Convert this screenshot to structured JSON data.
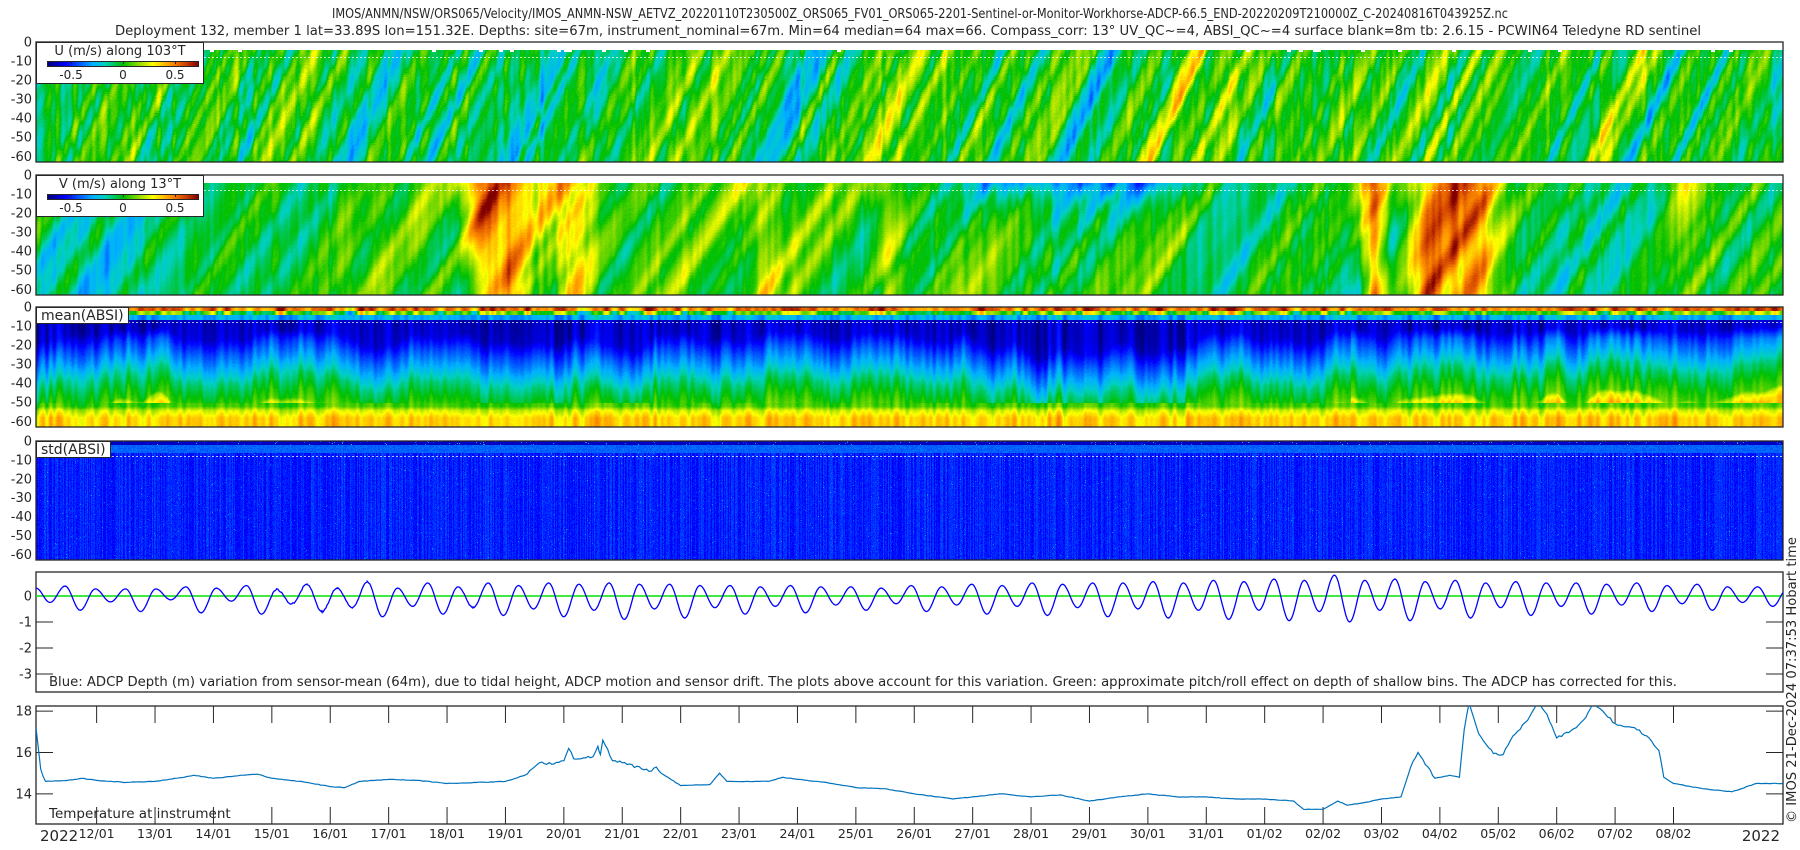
{
  "title": {
    "line1": "IMOS/ANMN/NSW/ORS065/Velocity/IMOS_ANMN-NSW_AETVZ_20220110T230500Z_ORS065_FV01_ORS065-2201-Sentinel-or-Monitor-Workhorse-ADCP-66.5_END-20220209T210000Z_C-20240816T043925Z.nc",
    "line2": "Deployment 132, member 1 lat=33.89S lon=151.32E. Depths: site=67m, instrument_nominal=67m. Min=64 median=64 max=66. Compass_corr: 13° UV_QC~=4, ABSI_QC~=4 surface blank=8m tb: 2.6.15 - PCWIN64 Teledyne RD sentinel"
  },
  "credit": "© IMOS 21-Dec-2024 07:37:53 Hobart time",
  "time_axis": {
    "start": "2022-01-10T23:05",
    "end": "2022-02-09T21:00",
    "year_left": "2022",
    "year_right": "2022",
    "ticks": [
      {
        "date": "2022-01-12",
        "label": "12/01"
      },
      {
        "date": "2022-01-13",
        "label": "13/01"
      },
      {
        "date": "2022-01-14",
        "label": "14/01"
      },
      {
        "date": "2022-01-15",
        "label": "15/01"
      },
      {
        "date": "2022-01-16",
        "label": "16/01"
      },
      {
        "date": "2022-01-17",
        "label": "17/01"
      },
      {
        "date": "2022-01-18",
        "label": "18/01"
      },
      {
        "date": "2022-01-19",
        "label": "19/01"
      },
      {
        "date": "2022-01-20",
        "label": "20/01"
      },
      {
        "date": "2022-01-21",
        "label": "21/01"
      },
      {
        "date": "2022-01-22",
        "label": "22/01"
      },
      {
        "date": "2022-01-23",
        "label": "23/01"
      },
      {
        "date": "2022-01-24",
        "label": "24/01"
      },
      {
        "date": "2022-01-25",
        "label": "25/01"
      },
      {
        "date": "2022-01-26",
        "label": "26/01"
      },
      {
        "date": "2022-01-27",
        "label": "27/01"
      },
      {
        "date": "2022-01-28",
        "label": "28/01"
      },
      {
        "date": "2022-01-29",
        "label": "29/01"
      },
      {
        "date": "2022-01-30",
        "label": "30/01"
      },
      {
        "date": "2022-01-31",
        "label": "31/01"
      },
      {
        "date": "2022-02-01",
        "label": "01/02"
      },
      {
        "date": "2022-02-02",
        "label": "02/02"
      },
      {
        "date": "2022-02-03",
        "label": "03/02"
      },
      {
        "date": "2022-02-04",
        "label": "04/02"
      },
      {
        "date": "2022-02-05",
        "label": "05/02"
      },
      {
        "date": "2022-02-06",
        "label": "06/02"
      },
      {
        "date": "2022-02-07",
        "label": "07/02"
      },
      {
        "date": "2022-02-08",
        "label": "08/02"
      }
    ]
  },
  "colors": {
    "frame": "#262626",
    "depth_line": "#0000ff",
    "pitch_roll_line": "#00e000",
    "temperature_line": "#0072bd"
  },
  "panels": {
    "u": {
      "legend": "U (m/s) along 103°T",
      "colorbar_ticks": [
        "-0.5",
        "0",
        "0.5"
      ],
      "y_ticks": [
        "0",
        "-10",
        "-20",
        "-30",
        "-40",
        "-50",
        "-60"
      ]
    },
    "v": {
      "legend": "V (m/s) along 13°T",
      "colorbar_ticks": [
        "-0.5",
        "0",
        "0.5"
      ],
      "y_ticks": [
        "0",
        "-10",
        "-20",
        "-30",
        "-40",
        "-50",
        "-60"
      ]
    },
    "mean_absi": {
      "legend": "mean(ABSI)",
      "y_ticks": [
        "0",
        "-10",
        "-20",
        "-30",
        "-40",
        "-50",
        "-60"
      ]
    },
    "std_absi": {
      "legend": "std(ABSI)",
      "y_ticks": [
        "0",
        "-10",
        "-20",
        "-30",
        "-40",
        "-50",
        "-60"
      ]
    },
    "depth": {
      "caption": "Blue: ADCP Depth (m) variation from sensor-mean (64m), due to tidal height, ADCP motion and sensor drift. The plots above account for this variation. Green: approximate pitch/roll effect on depth of shallow bins. The ADCP has corrected for this.",
      "y_ticks": [
        "0",
        "-1",
        "-2",
        "-3"
      ]
    },
    "temperature": {
      "label": "Temperature at instrument",
      "y_ticks": [
        "14",
        "16",
        "18"
      ]
    }
  },
  "chart_data": [
    {
      "type": "heatmap",
      "quantity": "U (m/s) along 103°T",
      "colormap": "jet",
      "clim": [
        -0.75,
        0.75
      ],
      "ylim": [
        -63,
        0
      ],
      "surface_blank_m": 8
    },
    {
      "type": "heatmap",
      "quantity": "V (m/s) along 13°T",
      "colormap": "jet",
      "clim": [
        -0.75,
        0.75
      ],
      "ylim": [
        -63,
        0
      ],
      "surface_blank_m": 8
    },
    {
      "type": "heatmap",
      "quantity": "mean(ABSI)",
      "colormap": "jet",
      "ylim": [
        -63,
        0
      ]
    },
    {
      "type": "heatmap",
      "quantity": "std(ABSI)",
      "colormap": "jet",
      "ylim": [
        -63,
        0
      ]
    },
    {
      "type": "line",
      "ylim": [
        -3.69,
        0.92
      ],
      "grid": false,
      "series": [
        {
          "color": "#0000ff",
          "start_value": 0.3,
          "first_extreme": "2022-01-11T04:50",
          "extreme_interval_hours": 6.21,
          "extremes": [
            -0.25,
            0.38,
            -0.55,
            0.27,
            -0.23,
            0.27,
            -0.6,
            0.27,
            -0.15,
            0.35,
            -0.65,
            0.3,
            -0.2,
            0.4,
            -0.7,
            0.25,
            -0.3,
            0.45,
            -0.6,
            0.3,
            -0.45,
            0.55,
            -0.8,
            0.3,
            -0.4,
            0.5,
            -0.7,
            0.35,
            -0.45,
            0.5,
            -0.75,
            0.4,
            -0.5,
            0.5,
            -0.8,
            0.45,
            -0.55,
            0.5,
            -0.9,
            0.45,
            -0.5,
            0.45,
            -0.85,
            0.4,
            -0.45,
            0.4,
            -0.7,
            0.35,
            -0.4,
            0.4,
            -0.65,
            0.35,
            -0.35,
            0.35,
            -0.55,
            0.3,
            -0.3,
            0.4,
            -0.6,
            0.35,
            -0.35,
            0.45,
            -0.7,
            0.4,
            -0.4,
            0.5,
            -0.75,
            0.45,
            -0.45,
            0.5,
            -0.8,
            0.5,
            -0.5,
            0.55,
            -0.85,
            0.5,
            -0.55,
            0.6,
            -0.9,
            0.55,
            -0.55,
            0.65,
            -0.95,
            0.6,
            -0.6,
            0.8,
            -1.0,
            0.6,
            -0.55,
            0.65,
            -0.95,
            0.55,
            -0.5,
            0.6,
            -0.85,
            0.5,
            -0.45,
            0.55,
            -0.75,
            0.5,
            -0.4,
            0.5,
            -0.7,
            0.45,
            -0.35,
            0.5,
            -0.6,
            0.4,
            -0.3,
            0.45,
            -0.55,
            0.35,
            -0.25,
            0.35,
            -0.4,
            0.3,
            -0.15,
            0.25,
            -0.35,
            0.2
          ]
        },
        {
          "color": "#00e000",
          "constant": 0
        }
      ]
    },
    {
      "type": "line",
      "ylim": [
        12.54,
        18.25
      ],
      "grid": false,
      "series": [
        {
          "color": "#0072bd",
          "points": [
            [
              "2022-01-10T23:05",
              17.2
            ],
            [
              "2022-01-11T01:00",
              15.2
            ],
            [
              "2022-01-11T03:00",
              14.6
            ],
            [
              "2022-01-11T12:00",
              14.65
            ],
            [
              "2022-01-11T18:00",
              14.75
            ],
            [
              "2022-01-12T00:00",
              14.65
            ],
            [
              "2022-01-12T12:00",
              14.55
            ],
            [
              "2022-01-13T00:00",
              14.6
            ],
            [
              "2022-01-13T12:00",
              14.8
            ],
            [
              "2022-01-13T16:00",
              14.9
            ],
            [
              "2022-01-14T00:00",
              14.75
            ],
            [
              "2022-01-14T12:00",
              14.9
            ],
            [
              "2022-01-14T18:00",
              14.95
            ],
            [
              "2022-01-15T00:00",
              14.75
            ],
            [
              "2022-01-15T12:00",
              14.6
            ],
            [
              "2022-01-16T00:00",
              14.35
            ],
            [
              "2022-01-16T06:00",
              14.3
            ],
            [
              "2022-01-16T12:00",
              14.6
            ],
            [
              "2022-01-17T00:00",
              14.7
            ],
            [
              "2022-01-17T12:00",
              14.65
            ],
            [
              "2022-01-18T00:00",
              14.5
            ],
            [
              "2022-01-18T12:00",
              14.55
            ],
            [
              "2022-01-19T00:00",
              14.6
            ],
            [
              "2022-01-19T08:00",
              14.9
            ],
            [
              "2022-01-19T14:00",
              15.5
            ],
            [
              "2022-01-19T20:00",
              15.45
            ],
            [
              "2022-01-20T00:00",
              15.6
            ],
            [
              "2022-01-20T02:00",
              16.2
            ],
            [
              "2022-01-20T04:00",
              15.7
            ],
            [
              "2022-01-20T12:00",
              15.8
            ],
            [
              "2022-01-20T14:00",
              16.3
            ],
            [
              "2022-01-20T15:00",
              15.9
            ],
            [
              "2022-01-20T16:00",
              16.6
            ],
            [
              "2022-01-20T20:00",
              15.6
            ],
            [
              "2022-01-21T00:00",
              15.5
            ],
            [
              "2022-01-21T12:00",
              15.1
            ],
            [
              "2022-01-21T14:00",
              15.3
            ],
            [
              "2022-01-21T16:00",
              15.0
            ],
            [
              "2022-01-22T00:00",
              14.4
            ],
            [
              "2022-01-22T12:00",
              14.45
            ],
            [
              "2022-01-22T16:00",
              15.0
            ],
            [
              "2022-01-22T19:00",
              14.6
            ],
            [
              "2022-01-23T12:00",
              14.6
            ],
            [
              "2022-01-23T18:00",
              14.8
            ],
            [
              "2022-01-24T00:00",
              14.7
            ],
            [
              "2022-01-24T12:00",
              14.55
            ],
            [
              "2022-01-25T00:00",
              14.3
            ],
            [
              "2022-01-25T12:00",
              14.25
            ],
            [
              "2022-01-26T00:00",
              14.0
            ],
            [
              "2022-01-26T16:00",
              13.75
            ],
            [
              "2022-01-27T00:00",
              13.85
            ],
            [
              "2022-01-27T12:00",
              14.0
            ],
            [
              "2022-01-28T00:00",
              13.85
            ],
            [
              "2022-01-28T12:00",
              13.95
            ],
            [
              "2022-01-29T00:00",
              13.65
            ],
            [
              "2022-01-29T12:00",
              13.85
            ],
            [
              "2022-01-30T00:00",
              14.0
            ],
            [
              "2022-01-30T12:00",
              13.85
            ],
            [
              "2022-01-31T00:00",
              13.85
            ],
            [
              "2022-01-31T12:00",
              13.75
            ],
            [
              "2022-02-01T00:00",
              13.75
            ],
            [
              "2022-02-01T12:00",
              13.65
            ],
            [
              "2022-02-01T16:00",
              13.25
            ],
            [
              "2022-02-02T00:00",
              13.25
            ],
            [
              "2022-02-02T06:00",
              13.65
            ],
            [
              "2022-02-02T10:00",
              13.45
            ],
            [
              "2022-02-02T18:00",
              13.6
            ],
            [
              "2022-02-03T00:00",
              13.75
            ],
            [
              "2022-02-03T08:00",
              13.85
            ],
            [
              "2022-02-03T12:00",
              15.3
            ],
            [
              "2022-02-03T15:00",
              16.0
            ],
            [
              "2022-02-03T22:00",
              14.75
            ],
            [
              "2022-02-04T04:00",
              14.9
            ],
            [
              "2022-02-04T08:00",
              14.8
            ],
            [
              "2022-02-04T10:00",
              17.1
            ],
            [
              "2022-02-04T12:00",
              18.4
            ],
            [
              "2022-02-04T16:00",
              16.9
            ],
            [
              "2022-02-04T22:00",
              15.95
            ],
            [
              "2022-02-05T02:00",
              15.9
            ],
            [
              "2022-02-05T06:00",
              16.8
            ],
            [
              "2022-02-05T12:00",
              17.55
            ],
            [
              "2022-02-05T16:00",
              18.4
            ],
            [
              "2022-02-05T20:00",
              17.85
            ],
            [
              "2022-02-06T00:00",
              16.7
            ],
            [
              "2022-02-06T08:00",
              17.2
            ],
            [
              "2022-02-06T12:00",
              17.7
            ],
            [
              "2022-02-06T15:00",
              18.4
            ],
            [
              "2022-02-06T20:00",
              17.85
            ],
            [
              "2022-02-07T00:00",
              17.4
            ],
            [
              "2022-02-07T08:00",
              17.2
            ],
            [
              "2022-02-07T14:00",
              16.7
            ],
            [
              "2022-02-07T18:00",
              16.1
            ],
            [
              "2022-02-07T20:00",
              14.8
            ],
            [
              "2022-02-08T00:00",
              14.5
            ],
            [
              "2022-02-08T12:00",
              14.25
            ],
            [
              "2022-02-09T00:00",
              14.1
            ],
            [
              "2022-02-09T10:00",
              14.5
            ],
            [
              "2022-02-09T21:00",
              14.5
            ]
          ]
        }
      ]
    }
  ]
}
